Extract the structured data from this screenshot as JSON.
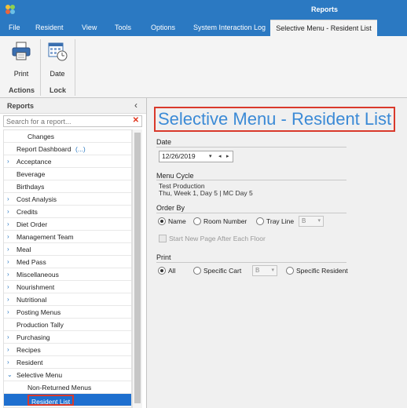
{
  "window": {
    "title": "Reports"
  },
  "menu": {
    "items": [
      "File",
      "Resident",
      "View",
      "Tools",
      "Options",
      "System Interaction Log"
    ],
    "active_tab": "Selective Menu - Resident List"
  },
  "ribbon": {
    "print_label": "Print",
    "date_label": "Date",
    "actions_group": "Actions",
    "lock_group": "Lock"
  },
  "reports_panel": {
    "title": "Reports",
    "collapse_glyph": "‹",
    "search_placeholder": "Search for a report...",
    "clear_glyph": "✕",
    "items": [
      {
        "label": "Changes",
        "indent": 2,
        "expander": false
      },
      {
        "label": "Report Dashboard",
        "more": "(...)",
        "indent": 0,
        "expander": false
      },
      {
        "label": "Acceptance",
        "indent": 0,
        "expander": true
      },
      {
        "label": "Beverage",
        "indent": 0,
        "expander": false
      },
      {
        "label": "Birthdays",
        "indent": 0,
        "expander": false
      },
      {
        "label": "Cost Analysis",
        "indent": 0,
        "expander": true
      },
      {
        "label": "Credits",
        "indent": 0,
        "expander": true
      },
      {
        "label": "Diet Order",
        "indent": 0,
        "expander": true
      },
      {
        "label": "Management Team",
        "indent": 0,
        "expander": true
      },
      {
        "label": "Meal",
        "indent": 0,
        "expander": true
      },
      {
        "label": "Med Pass",
        "indent": 0,
        "expander": true
      },
      {
        "label": "Miscellaneous",
        "indent": 0,
        "expander": true
      },
      {
        "label": "Nourishment",
        "indent": 0,
        "expander": true
      },
      {
        "label": "Nutritional",
        "indent": 0,
        "expander": true
      },
      {
        "label": "Posting Menus",
        "indent": 0,
        "expander": true
      },
      {
        "label": "Production Tally",
        "indent": 0,
        "expander": false
      },
      {
        "label": "Purchasing",
        "indent": 0,
        "expander": true
      },
      {
        "label": "Recipes",
        "indent": 0,
        "expander": true
      },
      {
        "label": "Resident",
        "indent": 0,
        "expander": true
      },
      {
        "label": "Selective Menu",
        "indent": 0,
        "expander": "open"
      },
      {
        "label": "Non-Returned Menus",
        "indent": 1,
        "expander": false
      },
      {
        "label": "Resident List",
        "indent": 1,
        "expander": false,
        "selected": true
      }
    ]
  },
  "content": {
    "title": "Selective Menu - Resident List",
    "date_section": "Date",
    "date_value": "12/26/2019",
    "menu_cycle_section": "Menu Cycle",
    "menu_cycle_line1": "Test Production",
    "menu_cycle_line2": "Thu, Week 1, Day 5 | MC Day 5",
    "order_by_section": "Order By",
    "order_by_options": [
      "Name",
      "Room Number",
      "Tray Line"
    ],
    "order_by_selected": "Name",
    "tray_line_value": "B",
    "start_new_page_label": "Start New Page After Each Floor",
    "print_section": "Print",
    "print_options": [
      "All",
      "Specific Cart",
      "Specific Resident"
    ],
    "print_selected": "All",
    "cart_value": "B"
  },
  "colors": {
    "titlebar": "#2b79c2",
    "title_text": "#3b8ad6",
    "highlight_border": "#d9392b",
    "selected_row": "#1e6fcf"
  }
}
